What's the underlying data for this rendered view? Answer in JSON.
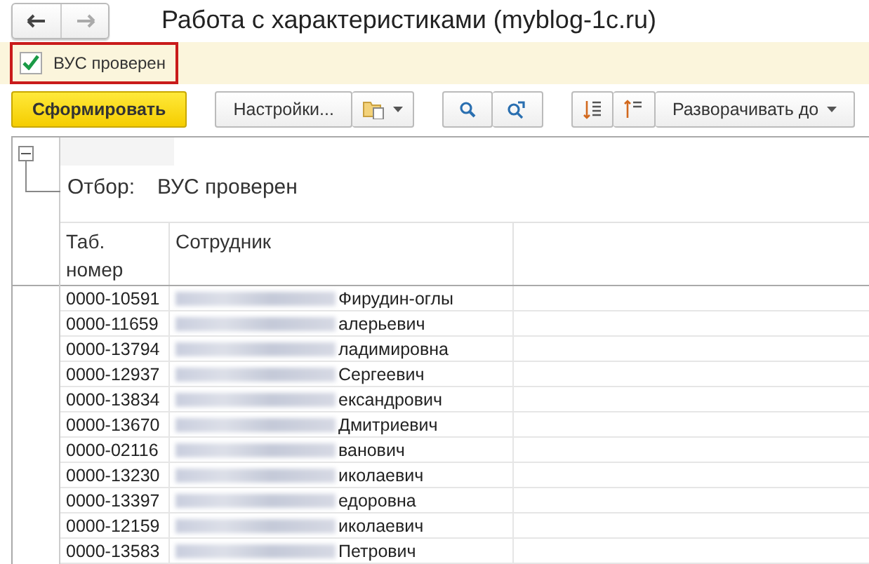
{
  "window": {
    "title": "Работа с характеристиками (myblog-1c.ru)"
  },
  "filter_checkbox": {
    "label": "ВУС проверен",
    "checked": true
  },
  "toolbar": {
    "generate_button": "Сформировать",
    "settings_button": "Настройки...",
    "expand_button": "Разворачивать до"
  },
  "report": {
    "expanded": true,
    "filter_label": "Отбор:",
    "filter_value": "ВУС проверен",
    "columns": [
      "Таб.\nномер",
      "Сотрудник"
    ],
    "rows": [
      {
        "number": "0000-10591",
        "name_visible": "Фирудин-оглы"
      },
      {
        "number": "0000-11659",
        "name_visible": "алерьевич"
      },
      {
        "number": "0000-13794",
        "name_visible": "ладимировна"
      },
      {
        "number": "0000-12937",
        "name_visible": "Сергеевич"
      },
      {
        "number": "0000-13834",
        "name_visible": "ександрович"
      },
      {
        "number": "0000-13670",
        "name_visible": "Дмитриевич"
      },
      {
        "number": "0000-02116",
        "name_visible": "ванович"
      },
      {
        "number": "0000-13230",
        "name_visible": "иколаевич"
      },
      {
        "number": "0000-13397",
        "name_visible": "едоровна"
      },
      {
        "number": "0000-12159",
        "name_visible": "иколаевич"
      },
      {
        "number": "0000-13583",
        "name_visible": "Петрович"
      }
    ]
  }
}
